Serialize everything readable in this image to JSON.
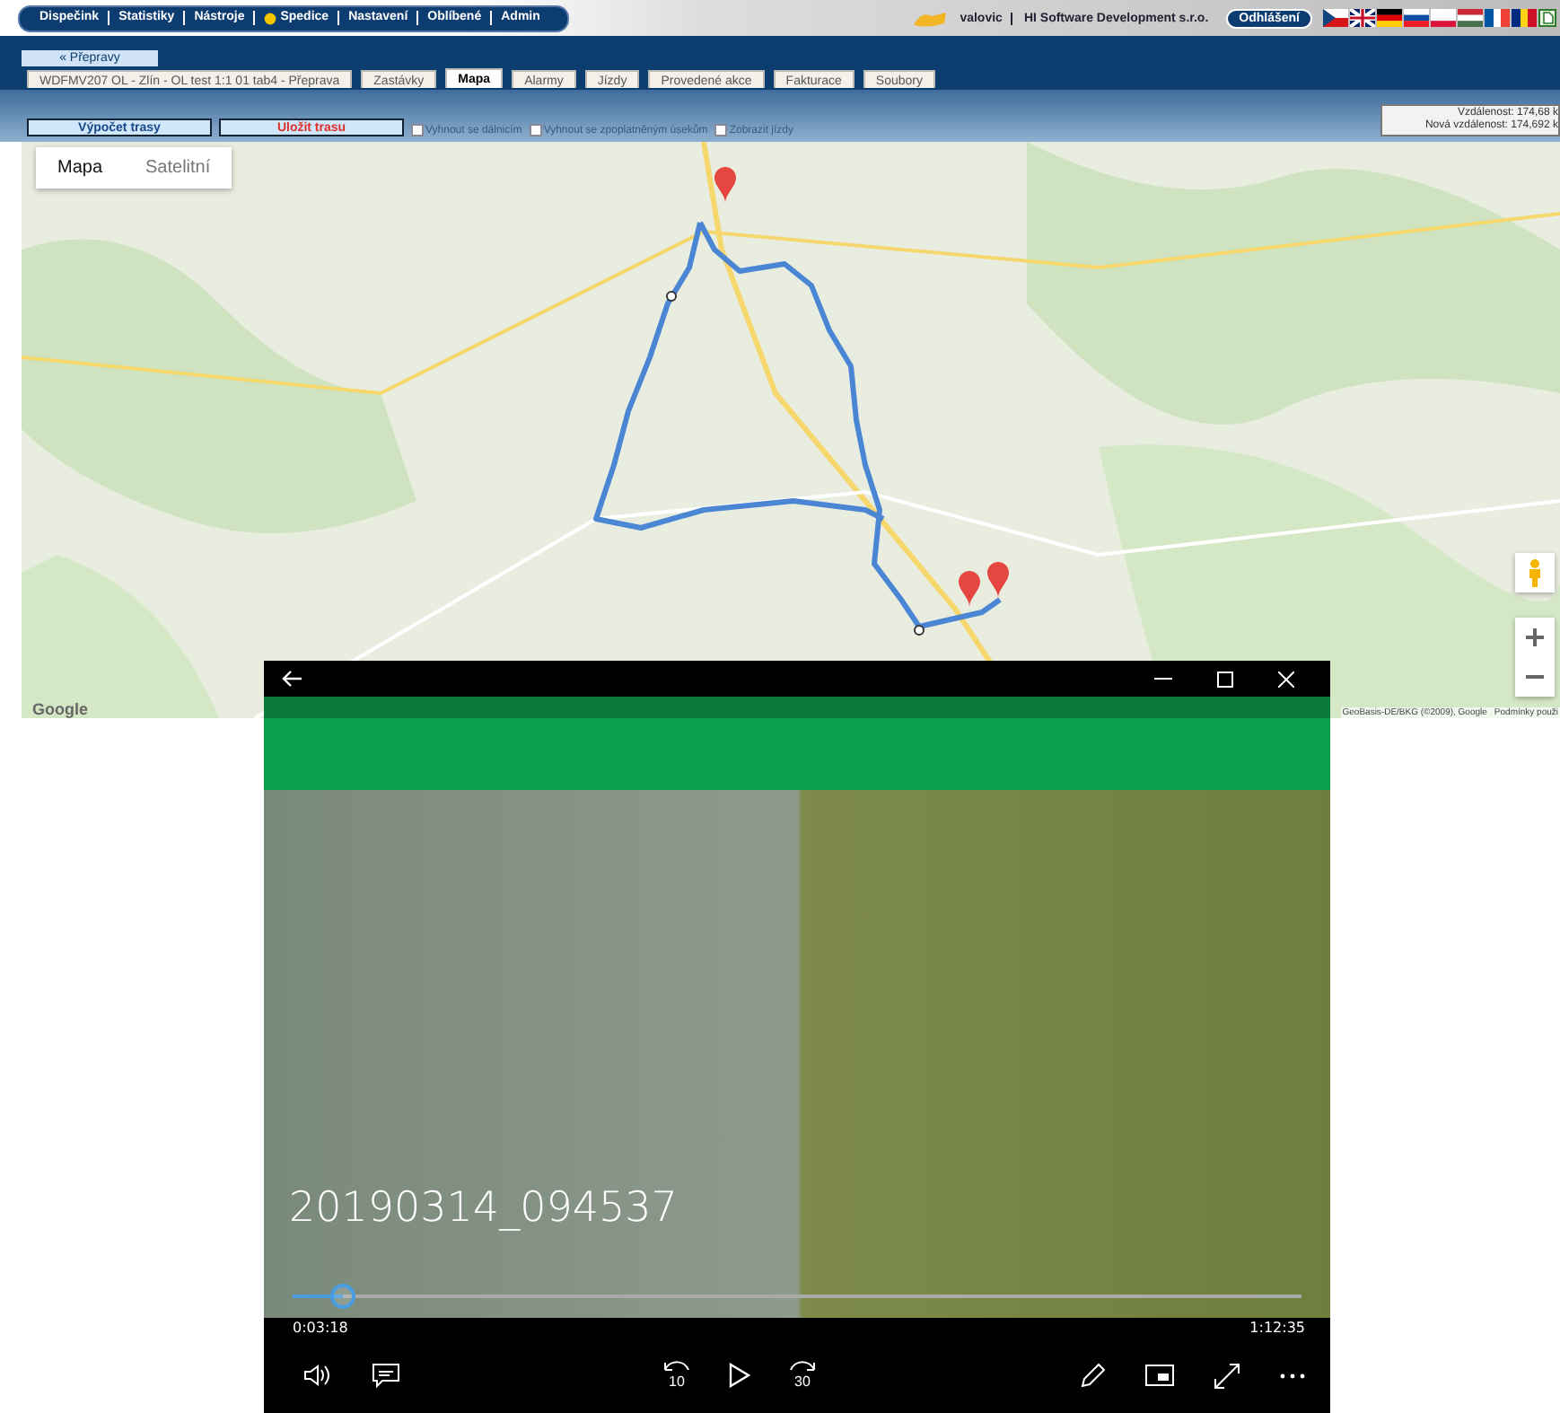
{
  "nav": {
    "items": [
      {
        "label": "Dispečink",
        "kind": "plain"
      },
      {
        "label": "Statistiky",
        "kind": "plain"
      },
      {
        "label": "Nástroje",
        "kind": "plain"
      },
      {
        "label": "Spedice",
        "kind": "dot"
      },
      {
        "label": "Nastavení",
        "kind": "plain"
      },
      {
        "label": "Oblíbené",
        "kind": "plain"
      },
      {
        "label": "Admin",
        "kind": "plain"
      }
    ]
  },
  "user": {
    "name": "valovic",
    "company": "HI Software Development s.r.o.",
    "logout": "Odhlášení"
  },
  "back_button": "« Přepravy",
  "tabs": [
    {
      "label": "WDFMV207 OL - Zlín - OL test 1:1 01 tab4 - Přeprava",
      "selected": false
    },
    {
      "label": "Zastávky",
      "selected": false
    },
    {
      "label": "Mapa",
      "selected": true
    },
    {
      "label": "Alarmy",
      "selected": false
    },
    {
      "label": "Jízdy",
      "selected": false
    },
    {
      "label": "Provedené akce",
      "selected": false
    },
    {
      "label": "Fakturace",
      "selected": false
    },
    {
      "label": "Soubory",
      "selected": false
    }
  ],
  "route_buttons": [
    {
      "label": "Výpočet trasy",
      "kind": "normal"
    },
    {
      "label": "Uložit trasu",
      "kind": "save"
    }
  ],
  "options": [
    {
      "label": "Vyhnout se dálnicím",
      "checked": false
    },
    {
      "label": "Vyhnout se zpoplatněným úsekům",
      "checked": false
    },
    {
      "label": "Zobrazit jízdy",
      "checked": false
    }
  ],
  "distance": {
    "current": "Vzdálenost: 174,68 k",
    "new": "Nová vzdálenost: 174,692 k"
  },
  "map": {
    "types": [
      {
        "label": "Mapa",
        "selected": true
      },
      {
        "label": "Satelitní",
        "selected": false
      }
    ],
    "logo": "Google",
    "attribution": "GeoBasis-DE/BKG (©2009), Google",
    "terms": "Podmínky použi"
  },
  "player": {
    "title": "20190314_094537",
    "elapsed": "0:03:18",
    "total": "1:12:35",
    "level": 0.05,
    "skip_back": "10",
    "skip_forward": "30"
  }
}
